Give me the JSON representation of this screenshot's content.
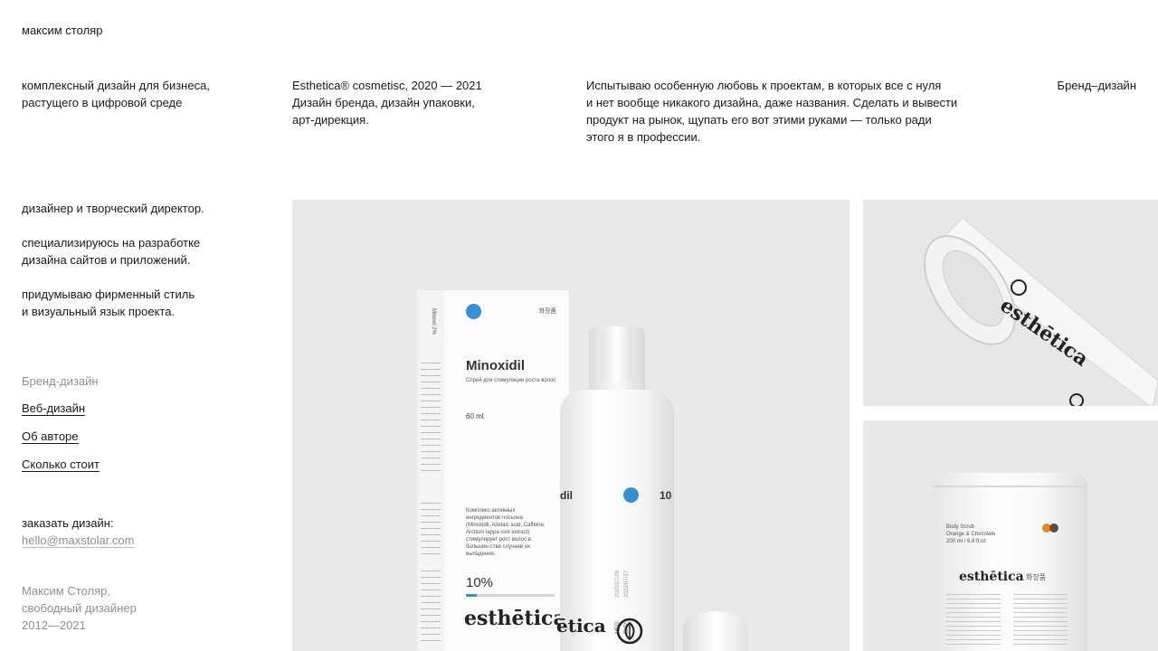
{
  "header": {
    "site_name": "максим столяр"
  },
  "intro": {
    "tagline_lines": [
      "комплексный дизайн для бизнеса,",
      "растущего в цифровой среде"
    ],
    "project_lines": [
      "Esthetica® cosmetisc, 2020 — 2021",
      "Дизайн бренда, дизайн упаковки,",
      "арт-дирекция."
    ],
    "description_lines": [
      "Испытываю особенную любовь к проектам, в которых все с нуля",
      "и нет вообще никакого дизайна, даже названия. Сделать и вывести",
      "продукт на рынок, щупать его вот этими руками — только ради",
      "этого я в профессии."
    ],
    "category": "Бренд–дизайн"
  },
  "about": {
    "p1": "дизайнер и творческий директор.",
    "p2_lines": [
      "специализируюсь на разработке",
      "дизайна сайтов и приложений."
    ],
    "p3_lines": [
      "придумываю фирменный стиль",
      "и визуальный язык проекта."
    ]
  },
  "nav": {
    "current": "Бренд-дизайн",
    "items": [
      "Веб-дизайн",
      "Об авторе",
      "Сколько стоит"
    ]
  },
  "contact": {
    "label": "заказать дизайн:",
    "email": "hello@maxstolar.com"
  },
  "footer": {
    "lines": [
      "Максим Столяр,",
      "свободный дизайнер",
      "2012—2021"
    ]
  },
  "gallery": {
    "product": {
      "title": "Minoxidil",
      "subtitle": "Спрей для стимуляции роста волос",
      "volume": "60 ml.",
      "korean": "화장품",
      "ingredients": "Комплекс активных ингредиентов лосьона (Minoxidil, Azelaic acid, Caffeine, Arctium lappa root extract) стимулирует рост волос в большин-стве случаев их выпадения.",
      "percent": "10%",
      "brand": "esthētica",
      "bottle_label": "dil",
      "bottle_percent": "10",
      "bottle_brand": "ētica",
      "mfg": "MFG:",
      "exp": "EXP:",
      "mfg_date": "2020/07/28",
      "exp_date": "2022/07/27",
      "box_side_label": "Minoxil 2%"
    },
    "tape": {
      "brand": "esthētica"
    },
    "pouch": {
      "brand": "esthētica",
      "korean": "화장품",
      "product_lines": [
        "Body Scrub",
        "Orange & Chocolate",
        "200 ml / 6.8 fl.oz"
      ]
    },
    "colors": {
      "accent_blue": "#3b8fd1",
      "pouch_orange": "#d98a2b",
      "pouch_brown": "#6b4a35"
    }
  }
}
